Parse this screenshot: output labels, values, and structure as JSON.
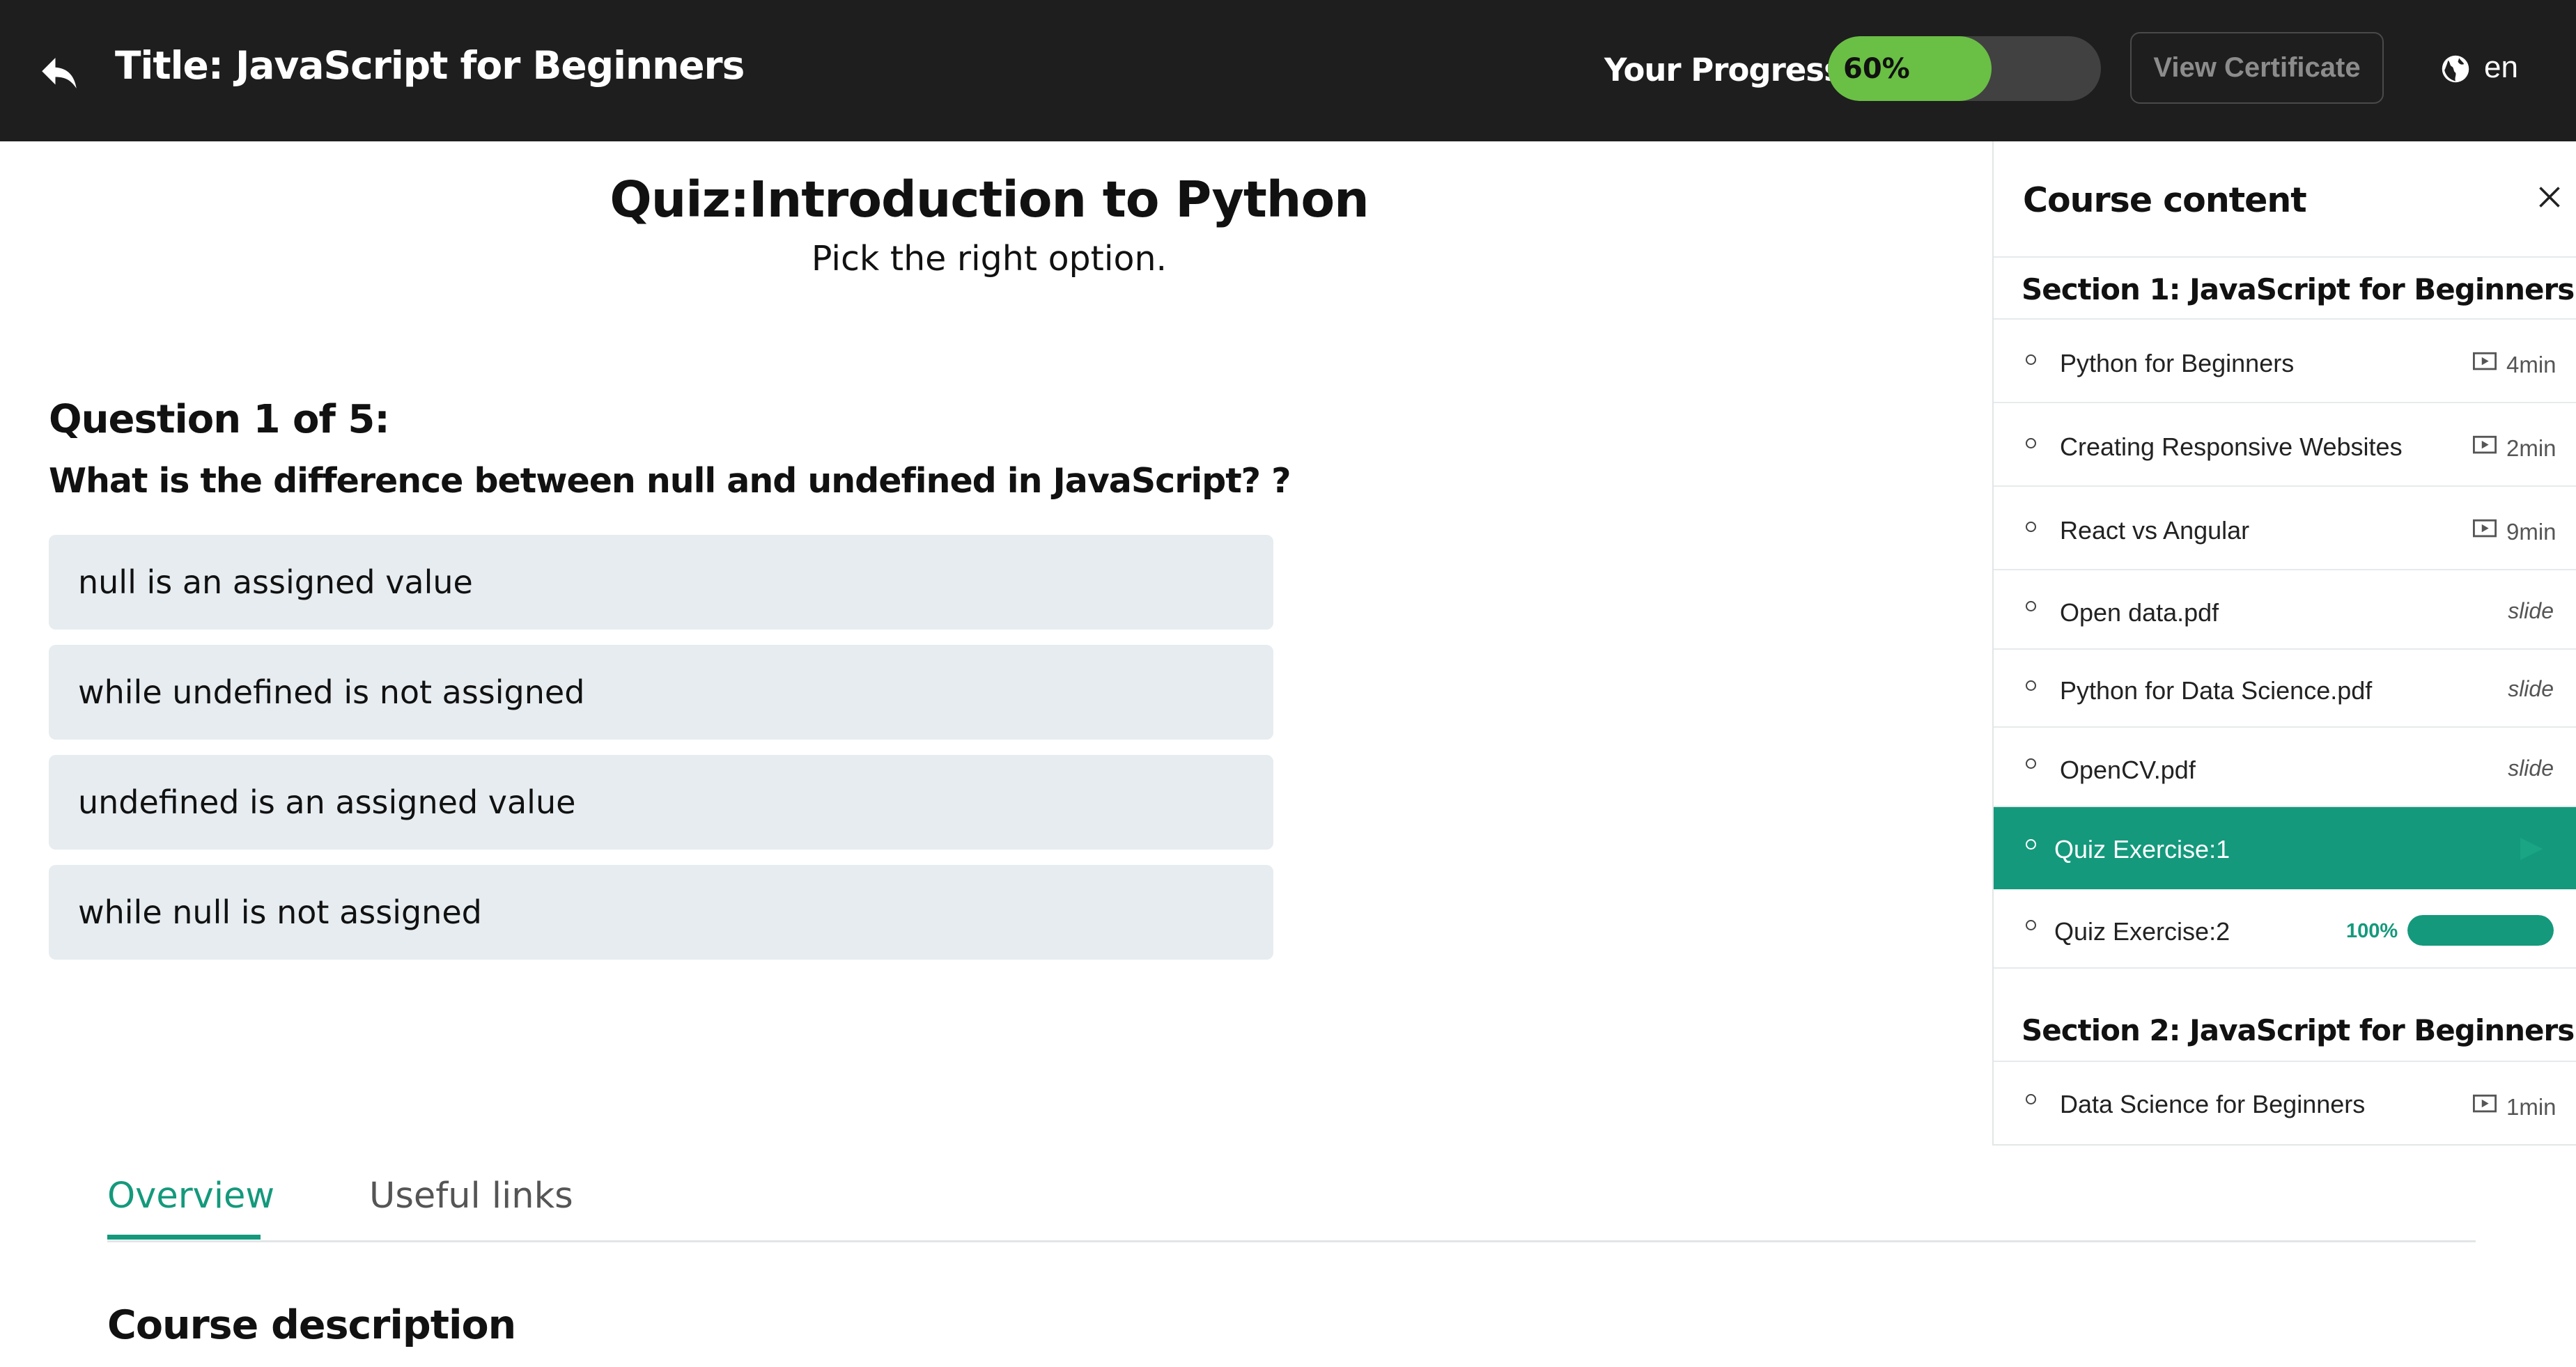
{
  "header": {
    "title": "Title: JavaScript for Beginners",
    "progress_label": "Your Progress",
    "progress_value": 0.6,
    "progress_text": "60%",
    "certificate_button": "View Certificate",
    "language": "en",
    "icons": {
      "back": "back-arrow-icon",
      "language": "globe-icon"
    }
  },
  "quiz": {
    "title": "Quiz:Introduction to Python",
    "subtitle": "Pick the right option.",
    "question_number": "Question 1 of 5:",
    "question_text": "What is the difference between null and undefined in JavaScript? ?",
    "options": [
      "null is an assigned value",
      "while undefined is not assigned",
      "undefined is an assigned value",
      "while null is not assigned"
    ]
  },
  "sidebar": {
    "title": "Course content",
    "close_icon": "close-icon",
    "sections": [
      {
        "heading": "Section 1: JavaScript for Beginners",
        "lessons": [
          {
            "name": "Python for Beginners",
            "duration": "4min",
            "icon": "video-icon"
          },
          {
            "name": "Creating Responsive Websites",
            "duration": "2min",
            "icon": "video-icon"
          },
          {
            "name": "React vs Angular",
            "duration": "9min",
            "icon": "video-icon"
          },
          {
            "name": "Open data.pdf",
            "type": "slide"
          },
          {
            "name": "Python for Data Science.pdf",
            "type": "slide"
          },
          {
            "name": "OpenCV.pdf",
            "type": "slide"
          },
          {
            "name": "Quiz Exercise:1",
            "active": true
          },
          {
            "name": "Quiz Exercise:2",
            "progress_text": "100%",
            "progress_value": 1.0
          }
        ]
      },
      {
        "heading": "Section 2: JavaScript for Beginners",
        "lessons": [
          {
            "name": "Data Science for Beginners",
            "duration": "1min",
            "icon": "video-icon"
          }
        ]
      }
    ]
  },
  "tabs": {
    "overview": "Overview",
    "useful_links": "Useful links",
    "active": "overview"
  },
  "description_heading": "Course description",
  "colors": {
    "header_bg": "#1e1e1e",
    "progress_fill": "#6abf45",
    "accent": "#14997c",
    "option_bg": "#e6ecef"
  }
}
